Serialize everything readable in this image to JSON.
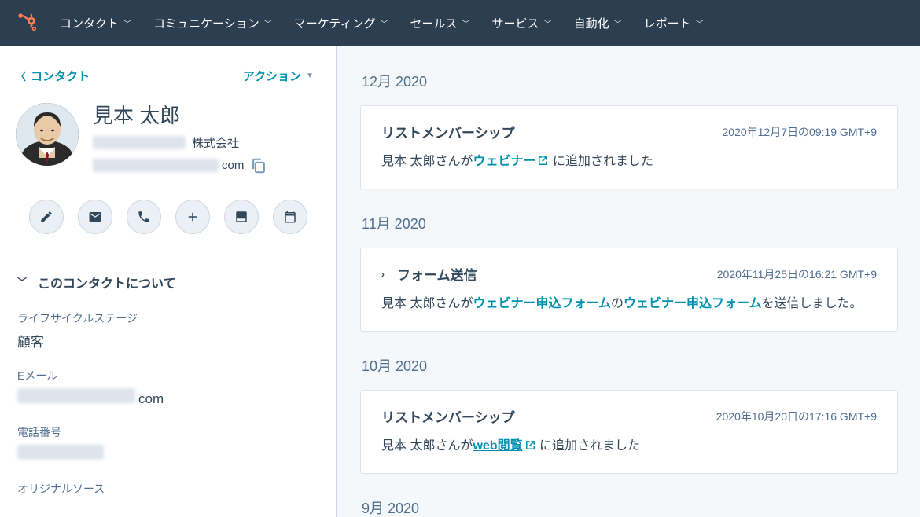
{
  "nav": {
    "items": [
      {
        "label": "コンタクト"
      },
      {
        "label": "コミュニケーション"
      },
      {
        "label": "マーケティング"
      },
      {
        "label": "セールス"
      },
      {
        "label": "サービス"
      },
      {
        "label": "自動化"
      },
      {
        "label": "レポート"
      }
    ]
  },
  "sidebar": {
    "back_label": "コンタクト",
    "actions_label": "アクション",
    "contact": {
      "name": "見本 太郎",
      "company_suffix": "株式会社",
      "email_suffix": "com"
    },
    "about": {
      "heading": "このコンタクトについて",
      "fields": [
        {
          "label": "ライフサイクルステージ",
          "value": "顧客",
          "blurred": false,
          "suffix": ""
        },
        {
          "label": "Eメール",
          "value": "",
          "blurred": true,
          "suffix": "com"
        },
        {
          "label": "電話番号",
          "value": "",
          "blurred": true,
          "suffix": ""
        },
        {
          "label": "オリジナルソース",
          "value": "",
          "blurred": false,
          "suffix": ""
        }
      ]
    }
  },
  "timeline": {
    "groups": [
      {
        "month": "12月 2020",
        "cards": [
          {
            "expandable": false,
            "title": "リストメンバーシップ",
            "stamp": "2020年12月7日の09:19 GMT+9",
            "body": {
              "prefix": "見本 太郎さんが",
              "link": "ウェビナー",
              "ext": true,
              "underline": false,
              "mid": "",
              "link2": "",
              "suffix": " に追加されました"
            }
          }
        ]
      },
      {
        "month": "11月 2020",
        "cards": [
          {
            "expandable": true,
            "title": "フォーム送信",
            "stamp": "2020年11月25日の16:21 GMT+9",
            "body": {
              "prefix": "見本 太郎さんが",
              "link": "ウェビナー申込フォーム",
              "ext": false,
              "underline": false,
              "mid": "の",
              "link2": "ウェビナー申込フォーム",
              "suffix": "を送信しました。"
            }
          }
        ]
      },
      {
        "month": "10月 2020",
        "cards": [
          {
            "expandable": false,
            "title": "リストメンバーシップ",
            "stamp": "2020年10月20日の17:16 GMT+9",
            "body": {
              "prefix": "見本 太郎さんが",
              "link": "web閲覧",
              "ext": true,
              "underline": true,
              "mid": "",
              "link2": "",
              "suffix": " に追加されました"
            }
          }
        ]
      },
      {
        "month": "9月 2020",
        "cards": []
      }
    ]
  }
}
